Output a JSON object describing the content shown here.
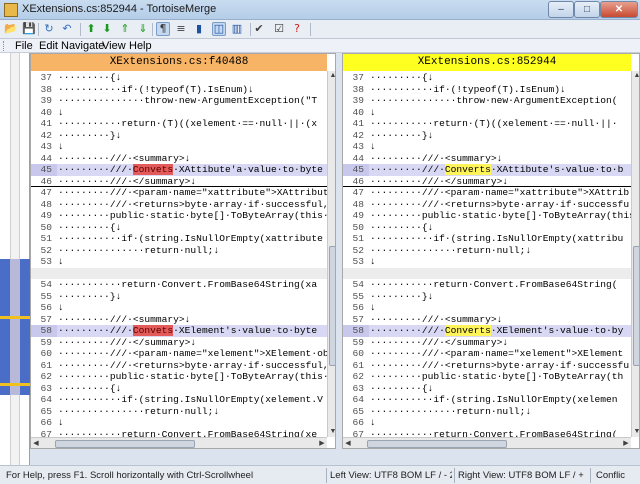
{
  "window": {
    "title": "XExtensions.cs:852944 - TortoiseMerge",
    "min": "–",
    "max": "□",
    "close": "✕"
  },
  "toolbar": {
    "icons": [
      "open-icon",
      "save-icon",
      "reload-icon",
      "undo-icon",
      "prev-diff-icon",
      "next-diff-icon",
      "prev-conflict-icon",
      "next-conflict-icon",
      "whitespace-icon",
      "inline-diff-icon",
      "one-pane-icon",
      "two-pane-icon",
      "three-pane-icon",
      "mark-resolved-icon",
      "settings-icon",
      "help-icon"
    ]
  },
  "menu": {
    "items": [
      "File",
      "Edit",
      "Navigate",
      "View",
      "Help"
    ]
  },
  "left": {
    "header": "XExtensions.cs:f40488",
    "rows": [
      {
        "n": "37",
        "t": "·········{↓",
        "k": ""
      },
      {
        "n": "38",
        "t": "···········if·(!typeof(T).IsEnum)↓",
        "k": ""
      },
      {
        "n": "39",
        "t": "···············throw·new·ArgumentException(\"T",
        "k": ""
      },
      {
        "n": "40",
        "t": "↓",
        "k": ""
      },
      {
        "n": "41",
        "t": "···········return·(T)((xelement·==·null·||·(x",
        "k": ""
      },
      {
        "n": "42",
        "t": "·········}↓",
        "k": ""
      },
      {
        "n": "43",
        "t": "↓",
        "k": ""
      },
      {
        "n": "44",
        "t": "·········///·<summary>↓",
        "k": ""
      },
      {
        "n": "45",
        "pre": "·········///·",
        "hl": "Convets",
        "post": "·XAttibute'a·value·to·byte",
        "k": "changed",
        "arrow": true
      },
      {
        "n": "46",
        "t": "·········///·</summary>↓",
        "k": "divider"
      },
      {
        "n": "47",
        "t": "·········///·<param·name=\"xattribute\">XAttribut",
        "k": ""
      },
      {
        "n": "48",
        "t": "·········///·<returns>byte·array·if·successful,",
        "k": ""
      },
      {
        "n": "49",
        "t": "·········public·static·byte[]·ToByteArray(this·X",
        "k": ""
      },
      {
        "n": "50",
        "t": "·········{↓",
        "k": ""
      },
      {
        "n": "51",
        "t": "···········if·(string.IsNullOrEmpty(xattribute",
        "k": ""
      },
      {
        "n": "52",
        "t": "···············return·null;↓",
        "k": ""
      },
      {
        "n": "53",
        "t": "↓",
        "k": ""
      },
      {
        "n": "",
        "t": "",
        "k": "empty"
      },
      {
        "n": "54",
        "t": "···········return·Convert.FromBase64String(xa",
        "k": ""
      },
      {
        "n": "55",
        "t": "·········}↓",
        "k": ""
      },
      {
        "n": "56",
        "t": "↓",
        "k": ""
      },
      {
        "n": "57",
        "t": "·········///·<summary>↓",
        "k": ""
      },
      {
        "n": "58",
        "pre": "·········///·",
        "hl": "Convets",
        "post": "·XElement's·value·to·byte",
        "k": "changed",
        "arrow": true
      },
      {
        "n": "59",
        "t": "·········///·</summary>↓",
        "k": ""
      },
      {
        "n": "60",
        "t": "·········///·<param·name=\"xelement\">XElement·ob",
        "k": ""
      },
      {
        "n": "61",
        "t": "·········///·<returns>byte·array·if·successful,",
        "k": ""
      },
      {
        "n": "62",
        "t": "·········public·static·byte[]·ToByteArray(this·X",
        "k": ""
      },
      {
        "n": "63",
        "t": "·········{↓",
        "k": ""
      },
      {
        "n": "64",
        "t": "···········if·(string.IsNullOrEmpty(xelement.V",
        "k": ""
      },
      {
        "n": "65",
        "t": "···············return·null;↓",
        "k": ""
      },
      {
        "n": "66",
        "t": "↓",
        "k": ""
      },
      {
        "n": "67",
        "t": "···········return·Convert.FromBase64String(xe",
        "k": ""
      }
    ]
  },
  "right": {
    "header": "XExtensions.cs:852944",
    "rows": [
      {
        "n": "37",
        "t": "·········{↓",
        "k": ""
      },
      {
        "n": "38",
        "t": "···········if·(!typeof(T).IsEnum)↓",
        "k": ""
      },
      {
        "n": "39",
        "t": "···············throw·new·ArgumentException(",
        "k": ""
      },
      {
        "n": "40",
        "t": "↓",
        "k": ""
      },
      {
        "n": "41",
        "t": "···········return·(T)((xelement·==·null·||·",
        "k": ""
      },
      {
        "n": "42",
        "t": "·········}↓",
        "k": ""
      },
      {
        "n": "43",
        "t": "↓",
        "k": ""
      },
      {
        "n": "44",
        "t": "·········///·<summary>↓",
        "k": ""
      },
      {
        "n": "45",
        "pre": "·········///·",
        "hl": "Converts",
        "post": "·XAttibute's·value·to·b",
        "k": "changed",
        "arrow": true
      },
      {
        "n": "46",
        "t": "·········///·</summary>↓",
        "k": "divider"
      },
      {
        "n": "47",
        "t": "·········///·<param·name=\"xattribute\">XAttrib",
        "k": ""
      },
      {
        "n": "48",
        "t": "·········///·<returns>byte·array·if·successfu",
        "k": ""
      },
      {
        "n": "49",
        "t": "·········public·static·byte[]·ToByteArray(this",
        "k": ""
      },
      {
        "n": "50",
        "t": "·········{↓",
        "k": ""
      },
      {
        "n": "51",
        "t": "···········if·(string.IsNullOrEmpty(xattribu",
        "k": ""
      },
      {
        "n": "52",
        "t": "···············return·null;↓",
        "k": ""
      },
      {
        "n": "53",
        "t": "↓",
        "k": ""
      },
      {
        "n": "",
        "t": "",
        "k": "empty"
      },
      {
        "n": "54",
        "t": "···········return·Convert.FromBase64String(",
        "k": ""
      },
      {
        "n": "55",
        "t": "·········}↓",
        "k": ""
      },
      {
        "n": "56",
        "t": "↓",
        "k": ""
      },
      {
        "n": "57",
        "t": "·········///·<summary>↓",
        "k": ""
      },
      {
        "n": "58",
        "pre": "·········///·",
        "hl": "Converts",
        "post": "·XElement's·value·to·by",
        "k": "changed",
        "arrow": true
      },
      {
        "n": "59",
        "t": "·········///·</summary>↓",
        "k": ""
      },
      {
        "n": "60",
        "t": "·········///·<param·name=\"xelement\">XElement",
        "k": ""
      },
      {
        "n": "61",
        "t": "·········///·<returns>byte·array·if·successfu",
        "k": ""
      },
      {
        "n": "62",
        "t": "·········public·static·byte[]·ToByteArray(th",
        "k": ""
      },
      {
        "n": "63",
        "t": "·········{↓",
        "k": ""
      },
      {
        "n": "64",
        "t": "···········if·(string.IsNullOrEmpty(xelemen",
        "k": ""
      },
      {
        "n": "65",
        "t": "···············return·null;↓",
        "k": ""
      },
      {
        "n": "66",
        "t": "↓",
        "k": ""
      },
      {
        "n": "67",
        "t": "···········return·Convert.FromBase64String(",
        "k": ""
      }
    ]
  },
  "status": {
    "help": "For Help, press F1. Scroll horizontally with Ctrl-Scrollwheel",
    "left_view": "Left View: UTF8 BOM LF  / - 2",
    "right_view": "Right View: UTF8 BOM LF  / + 2",
    "conflicts": "Conflic"
  },
  "colors": {
    "left_header": "#f7b466",
    "right_header": "#ffff20",
    "removed": "#e25a5a",
    "added": "#fff45a",
    "changed_row": "#d8d8f4"
  }
}
